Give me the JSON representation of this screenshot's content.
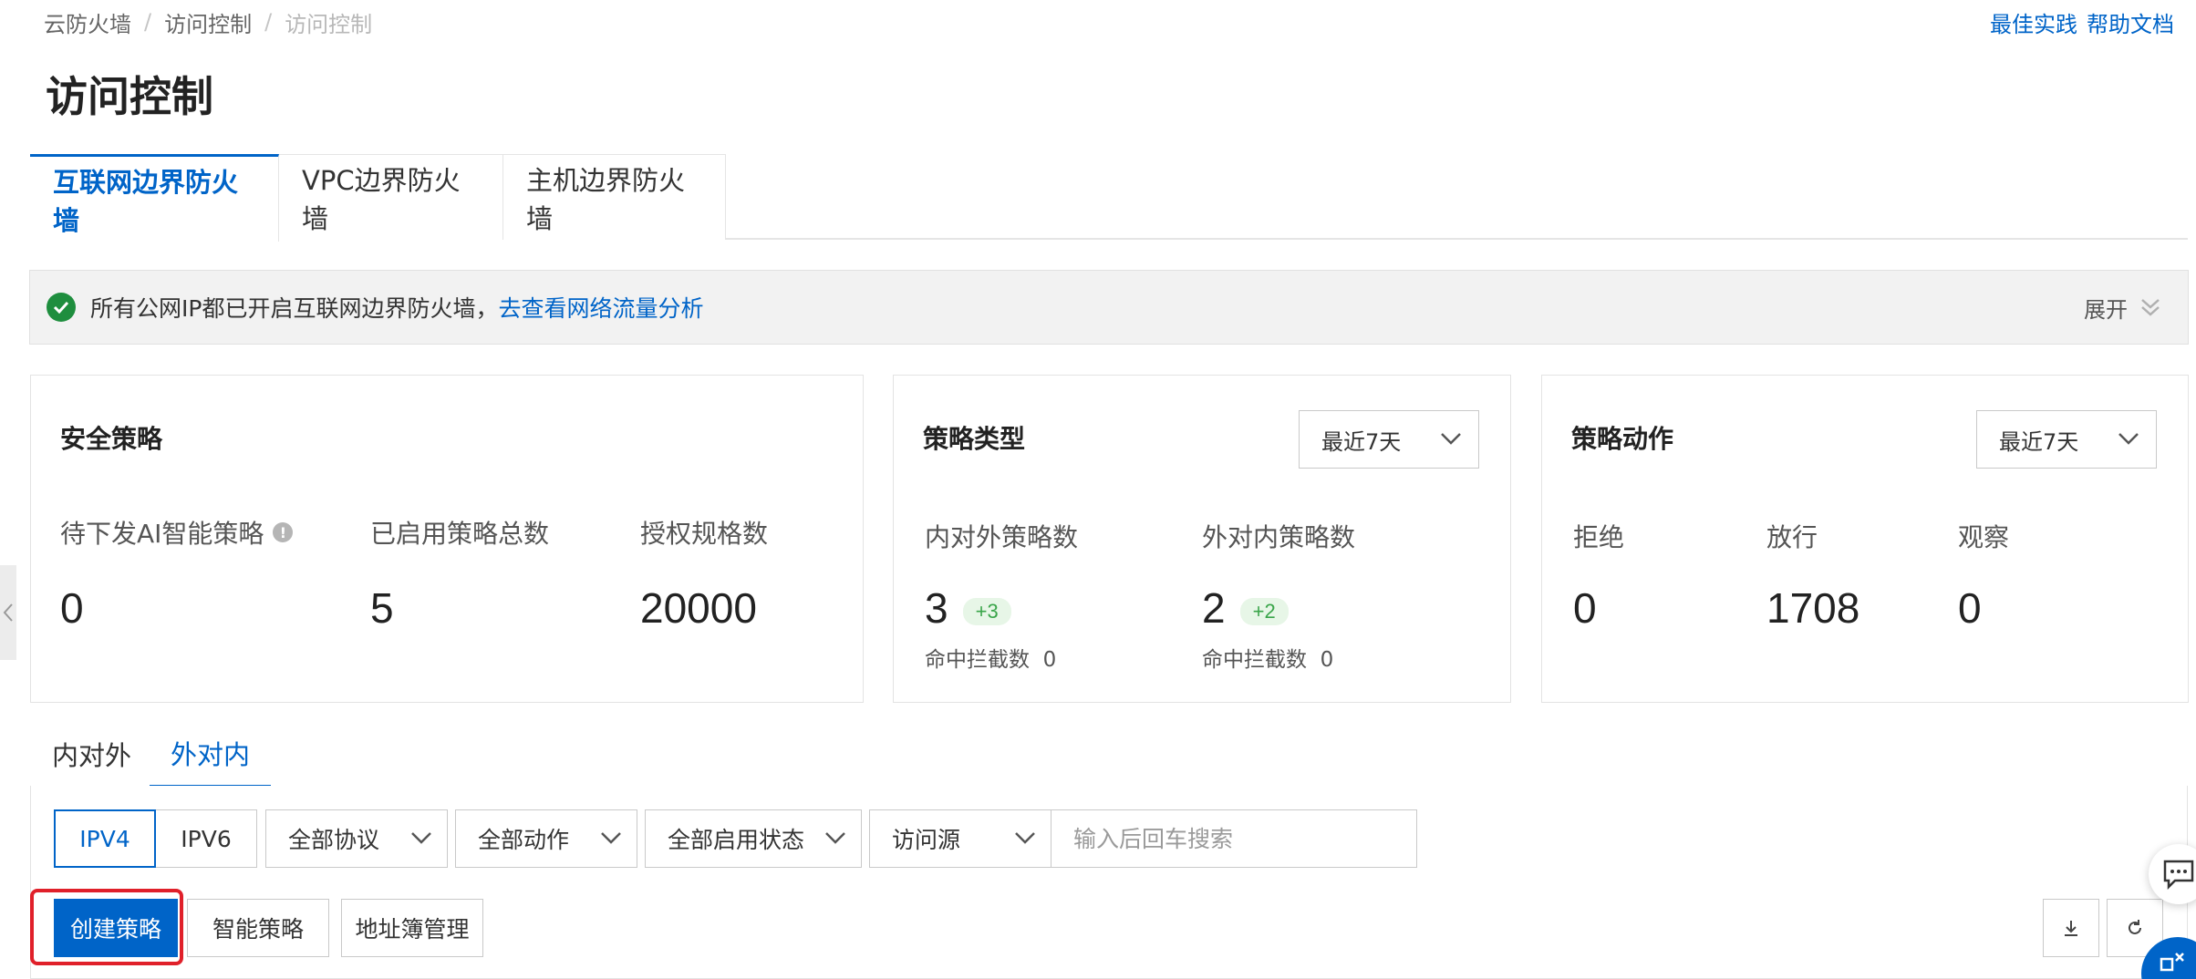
{
  "breadcrumb": [
    "云防火墙",
    "访问控制",
    "访问控制"
  ],
  "top_links": [
    "最佳实践",
    "帮助文档"
  ],
  "page_title": "访问控制",
  "main_tabs": [
    {
      "label": "互联网边界防火墙",
      "active": true
    },
    {
      "label": "VPC边界防火墙",
      "active": false
    },
    {
      "label": "主机边界防火墙",
      "active": false
    }
  ],
  "notice": {
    "text": "所有公网IP都已开启互联网边界防火墙，",
    "link": "去查看网络流量分析",
    "expand_label": "展开",
    "icon": "check-circle-icon"
  },
  "security_policy": {
    "title": "安全策略",
    "metrics": [
      {
        "label": "待下发AI智能策略",
        "value": "0"
      },
      {
        "label": "已启用策略总数",
        "value": "5"
      },
      {
        "label": "授权规格数",
        "value": "20000"
      }
    ]
  },
  "policy_type": {
    "title": "策略类型",
    "range": "最近7天",
    "metrics": [
      {
        "label": "内对外策略数",
        "value": "3",
        "delta": "+3",
        "hit_label": "命中拦截数",
        "hit_value": "0"
      },
      {
        "label": "外对内策略数",
        "value": "2",
        "delta": "+2",
        "hit_label": "命中拦截数",
        "hit_value": "0"
      }
    ]
  },
  "policy_action": {
    "title": "策略动作",
    "range": "最近7天",
    "metrics": [
      {
        "label": "拒绝",
        "value": "0"
      },
      {
        "label": "放行",
        "value": "1708"
      },
      {
        "label": "观察",
        "value": "0"
      }
    ]
  },
  "direction_tabs": [
    {
      "label": "内对外",
      "active": false
    },
    {
      "label": "外对内",
      "active": true
    }
  ],
  "filters": {
    "ip_versions": [
      {
        "label": "IPV4",
        "active": true
      },
      {
        "label": "IPV6",
        "active": false
      }
    ],
    "protocol": "全部协议",
    "action": "全部动作",
    "status": "全部启用状态",
    "source": "访问源",
    "search_placeholder": "输入后回车搜索"
  },
  "buttons": {
    "create": "创建策略",
    "smart": "智能策略",
    "address_book": "地址簿管理"
  },
  "colors": {
    "primary": "#0064c8",
    "success": "#1e8e3e",
    "highlight": "#e0202a"
  }
}
